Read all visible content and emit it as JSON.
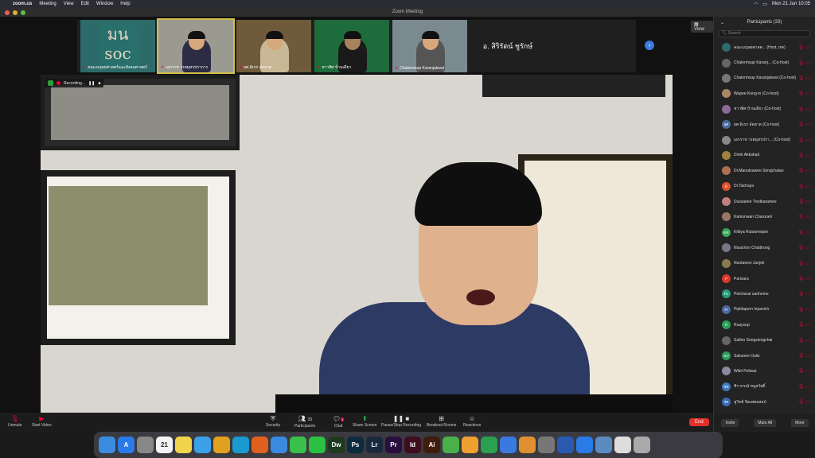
{
  "menubar": {
    "app": "zoom.us",
    "menus": [
      "Meeting",
      "View",
      "Edit",
      "Window",
      "Help"
    ],
    "datetime": "Mon 21 Jun  10:05"
  },
  "window": {
    "title": "Zoom Meeting"
  },
  "gallery": {
    "view_label": "View",
    "tiles": [
      {
        "name": "คณะมนุษยศาสตร์และสังคมศาสตร์",
        "logo": "มน soc"
      },
      {
        "name": "เอกราช วรสมุทรปราการ"
      },
      {
        "name": "ผศ.ดิเรก อัคฮาด"
      },
      {
        "name": "ชาวพิศ บ้านเดียว"
      },
      {
        "name": "Chalermsup Karanjakwut"
      },
      {
        "name": "อ. สิริรัตน์ ชูรักษ์"
      }
    ]
  },
  "recording": {
    "label": "Recording..."
  },
  "toolbar": {
    "unmute": "Unmute",
    "start_video": "Start Video",
    "security": "Security",
    "participants": "Participants",
    "participants_count": "33",
    "chat": "Chat",
    "chat_badge": "1",
    "share_screen": "Share Screen",
    "pause_stop_recording": "Pause/Stop Recording",
    "breakout_rooms": "Breakout Rooms",
    "reactions": "Reactions",
    "end": "End"
  },
  "panel": {
    "title": "Participants (33)",
    "search_placeholder": "Search",
    "participants": [
      {
        "name": "คณะมนุษยศาสต... (Host, me)",
        "initials": "",
        "color": "#2d6b6a"
      },
      {
        "name": "Chalermsup Karanj... (Co-host)",
        "initials": "",
        "color": "#666"
      },
      {
        "name": "Chalermsup Karanjakwut (Co-host)",
        "initials": "",
        "color": "#777"
      },
      {
        "name": "Wapee Kong-in (Co-host)",
        "initials": "",
        "color": "#aa8866"
      },
      {
        "name": "ชาวพิศ บ้านเดียว (Co-host)",
        "initials": "",
        "color": "#8a6a9a"
      },
      {
        "name": "ผศ.ดิเรก อัคฮาด (Co-host)",
        "initials": "ผศ",
        "color": "#4a6a9a"
      },
      {
        "name": "เอกราช วรสมุทรปรา... (Co-host)",
        "initials": "",
        "color": "#888"
      },
      {
        "name": "Direk Akkahad",
        "initials": "",
        "color": "#a08040"
      },
      {
        "name": "Dr.Manutsawee Sriraj­chalao",
        "initials": "",
        "color": "#b07050"
      },
      {
        "name": "Dr.Tachaya",
        "initials": "D",
        "color": "#d9532c"
      },
      {
        "name": "Dussadee Tredbaramee",
        "initials": "",
        "color": "#c08080"
      },
      {
        "name": "Kamonwan Charuneri",
        "initials": "",
        "color": "#997766"
      },
      {
        "name": "Kittiya Rutsamejam",
        "initials": "KR",
        "color": "#3aa556"
      },
      {
        "name": "Nisachon Chatthong",
        "initials": "",
        "color": "#777788"
      },
      {
        "name": "Nuntawon Junjek",
        "initials": "",
        "color": "#8a7a50"
      },
      {
        "name": "Parisara",
        "initials": "P",
        "color": "#d9382c"
      },
      {
        "name": "Petcharat uanhome",
        "initials": "Pu",
        "color": "#2a9a7a"
      },
      {
        "name": "Pipittaporn Inpanich",
        "initials": "PI",
        "color": "#4a6aa0"
      },
      {
        "name": "Ruaysup",
        "initials": "R",
        "color": "#2aa05a"
      },
      {
        "name": "Saifon Songsiengchai",
        "initials": "",
        "color": "#666"
      },
      {
        "name": "Sakunee Oulis",
        "initials": "SO",
        "color": "#2a9a5a"
      },
      {
        "name": "Wikit Poliwat",
        "initials": "",
        "color": "#8a8aa0"
      },
      {
        "name": "ชิรากรณ์ หนูสวัสดิ์",
        "initials": "ชห",
        "color": "#3a7ac0"
      },
      {
        "name": "ชูวิทย์ จิตเพศลสมบ์",
        "initials": "ชจ",
        "color": "#3a6ab0"
      }
    ],
    "invite": "Invite",
    "mute_all": "Mute All",
    "more": "More"
  },
  "dock": {
    "apps": [
      {
        "icon": "finder-icon",
        "label": "",
        "color": "#3b8be0"
      },
      {
        "icon": "app-store-icon",
        "label": "A",
        "color": "#2a7ae8"
      },
      {
        "icon": "launchpad-icon",
        "label": "",
        "color": "#888"
      },
      {
        "icon": "calendar-icon",
        "label": "21",
        "color": "#f4f4f4"
      },
      {
        "icon": "notes-icon",
        "label": "",
        "color": "#f3d34a"
      },
      {
        "icon": "safari-icon",
        "label": "",
        "color": "#3aa0e8"
      },
      {
        "icon": "chrome-icon",
        "label": "",
        "color": "#e0a020"
      },
      {
        "icon": "edge-icon",
        "label": "",
        "color": "#1a9ad0"
      },
      {
        "icon": "firefox-icon",
        "label": "",
        "color": "#e06020"
      },
      {
        "icon": "mail-icon",
        "label": "",
        "color": "#3a8ae0"
      },
      {
        "icon": "messages-icon",
        "label": "",
        "color": "#3ac04a"
      },
      {
        "icon": "line-icon",
        "label": "",
        "color": "#2ac040"
      },
      {
        "icon": "dreamweaver-icon",
        "label": "Dw",
        "color": "#1e3a1e"
      },
      {
        "icon": "photoshop-icon",
        "label": "Ps",
        "color": "#0e2a3e"
      },
      {
        "icon": "lightroom-icon",
        "label": "Lr",
        "color": "#1a2a3e"
      },
      {
        "icon": "premiere-icon",
        "label": "Pr",
        "color": "#2a0e3e"
      },
      {
        "icon": "indesign-icon",
        "label": "Id",
        "color": "#3e0e1e"
      },
      {
        "icon": "illustrator-icon",
        "label": "Ai",
        "color": "#3e1e0a"
      },
      {
        "icon": "maps-icon",
        "label": "",
        "color": "#4ab04a"
      },
      {
        "icon": "photos-icon",
        "label": "",
        "color": "#f0a030"
      },
      {
        "icon": "numbers-icon",
        "label": "",
        "color": "#2aa050"
      },
      {
        "icon": "keynote-icon",
        "label": "",
        "color": "#3a7ae0"
      },
      {
        "icon": "pages-icon",
        "label": "",
        "color": "#e09030"
      },
      {
        "icon": "system-preferences-icon",
        "label": "",
        "color": "#777"
      },
      {
        "icon": "word-icon",
        "label": "",
        "color": "#2a5ab0"
      },
      {
        "icon": "zoom-icon",
        "label": "",
        "color": "#2a7ae8"
      },
      {
        "icon": "preview-icon",
        "label": "",
        "color": "#5a8ac0"
      },
      {
        "icon": "documents-icon",
        "label": "",
        "color": "#ddd"
      },
      {
        "icon": "trash-icon",
        "label": "",
        "color": "#aaa"
      }
    ]
  },
  "colors": {
    "end": "#e0302a",
    "accent": "#3a7be0",
    "muted": "#e00033"
  }
}
